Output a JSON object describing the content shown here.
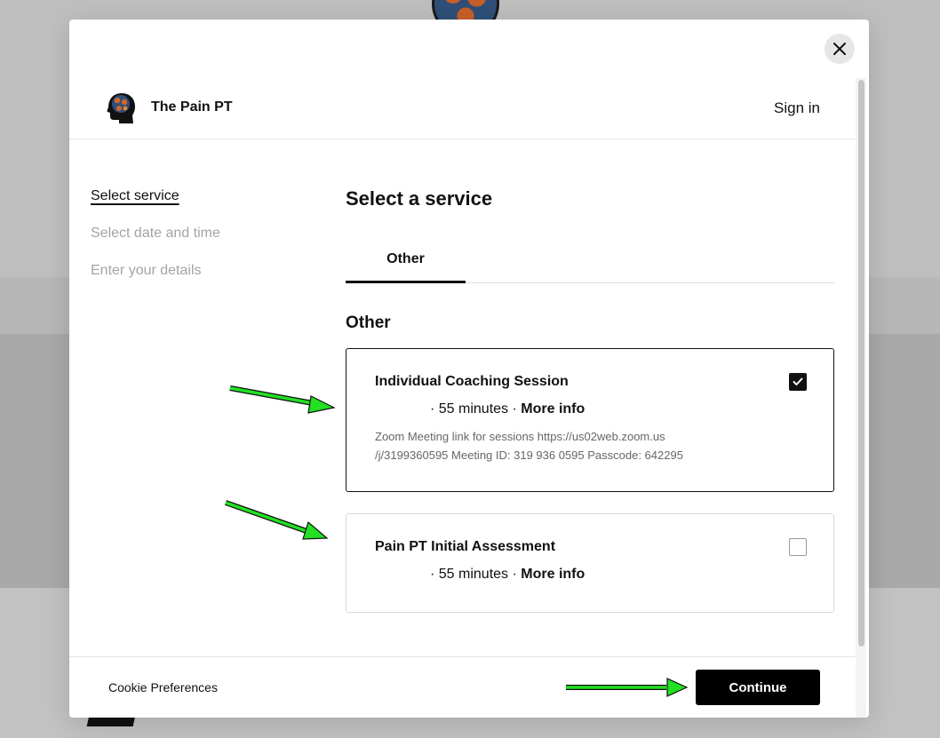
{
  "brand": {
    "name": "The Pain PT",
    "sign_in": "Sign in"
  },
  "close_label": "×",
  "steps": [
    {
      "label": "Select service",
      "active": true
    },
    {
      "label": "Select date and time",
      "active": false
    },
    {
      "label": "Enter your details",
      "active": false
    }
  ],
  "main": {
    "title": "Select a service",
    "tabs": [
      {
        "label": "Other",
        "selected": true
      }
    ],
    "section_title": "Other",
    "services": [
      {
        "name": "Individual Coaching Session",
        "duration": "· 55 minutes · ",
        "more_info": "More info",
        "description": "Zoom Meeting link for sessions https://us02web.zoom.us /j/3199360595 Meeting ID: 319 936 0595 Passcode: 642295",
        "selected": true
      },
      {
        "name": "Pain PT Initial Assessment",
        "duration": "· 55 minutes · ",
        "more_info": "More info",
        "selected": false
      }
    ]
  },
  "footer": {
    "cookie_label": "Cookie Preferences",
    "continue_label": "Continue"
  },
  "colors": {
    "accent": "#000000",
    "annotation_arrow": "#22e022",
    "selected_border": "#111111"
  },
  "icons": [
    "close-icon",
    "brand-logo-icon",
    "checkmark-icon",
    "arrow-annotation-icon"
  ]
}
